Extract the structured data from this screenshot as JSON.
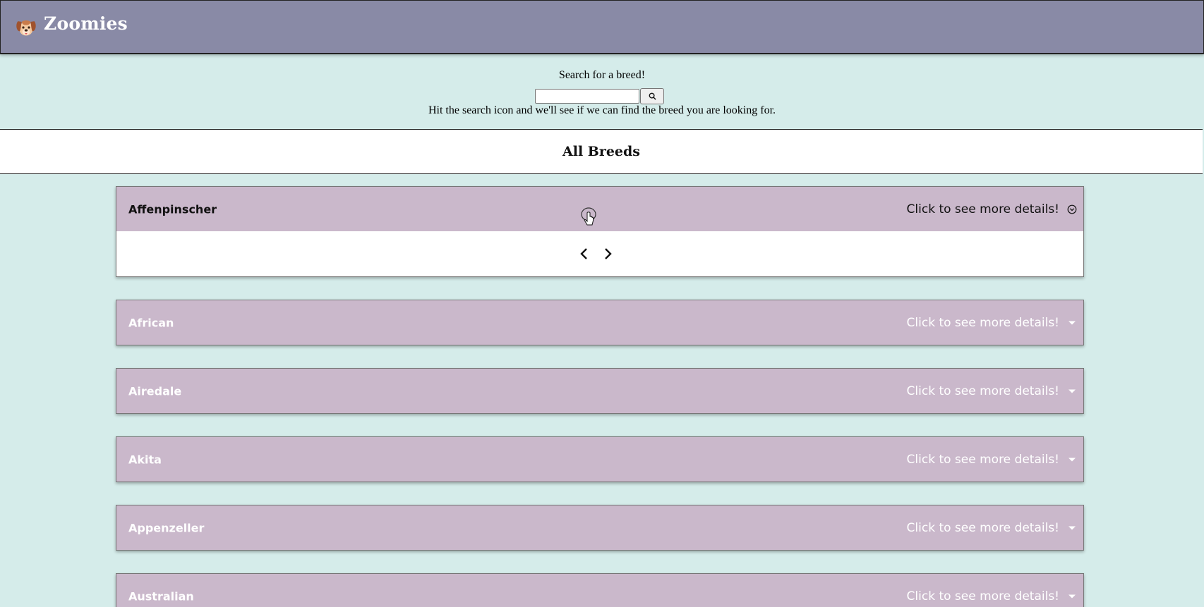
{
  "header": {
    "brand": "Zoomies",
    "logo_icon": "dog-face-icon"
  },
  "search": {
    "title": "Search for a breed!",
    "input_value": "",
    "placeholder": "",
    "button_icon": "magnifier-icon",
    "hint": "Hit the search icon and we'll see if we can find the breed you are looking for."
  },
  "breeds_section": {
    "title": "All Breeds",
    "more_label": "Click to see more details!",
    "items": [
      {
        "name": "Affenpinscher",
        "expanded": true
      },
      {
        "name": "African",
        "expanded": false
      },
      {
        "name": "Airedale",
        "expanded": false
      },
      {
        "name": "Akita",
        "expanded": false
      },
      {
        "name": "Appenzeller",
        "expanded": false
      },
      {
        "name": "Australian",
        "expanded": false
      }
    ]
  },
  "colors": {
    "navbar": "#898aa6",
    "page_background": "#d5ecea",
    "accordion_header": "#cab8cb",
    "white": "#ffffff"
  }
}
